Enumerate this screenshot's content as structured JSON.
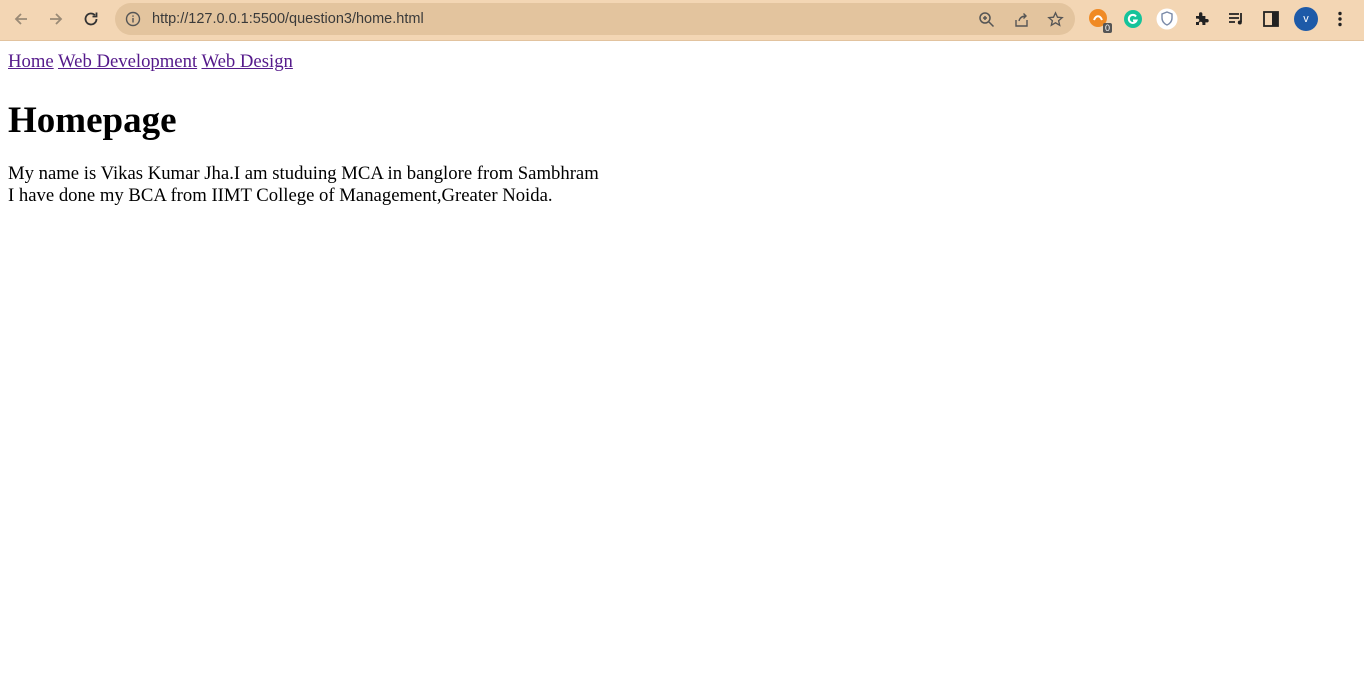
{
  "browser": {
    "url": "http://127.0.0.1:5500/question3/home.html",
    "extension_badge": "0",
    "profile_initial": "v",
    "colors": {
      "toolbar": "#f3d6b4",
      "omnibox": "#e3c49e",
      "visited_link": "#551a8b",
      "avatar": "#1d5aa8"
    }
  },
  "page": {
    "nav_links": [
      "Home",
      "Web Development",
      "Web Design"
    ],
    "heading": "Homepage",
    "paragraph_lines": [
      "My name is Vikas Kumar Jha.I am studuing MCA in banglore from Sambhram",
      "I have done my BCA from IIMT College of Management,Greater Noida."
    ]
  }
}
